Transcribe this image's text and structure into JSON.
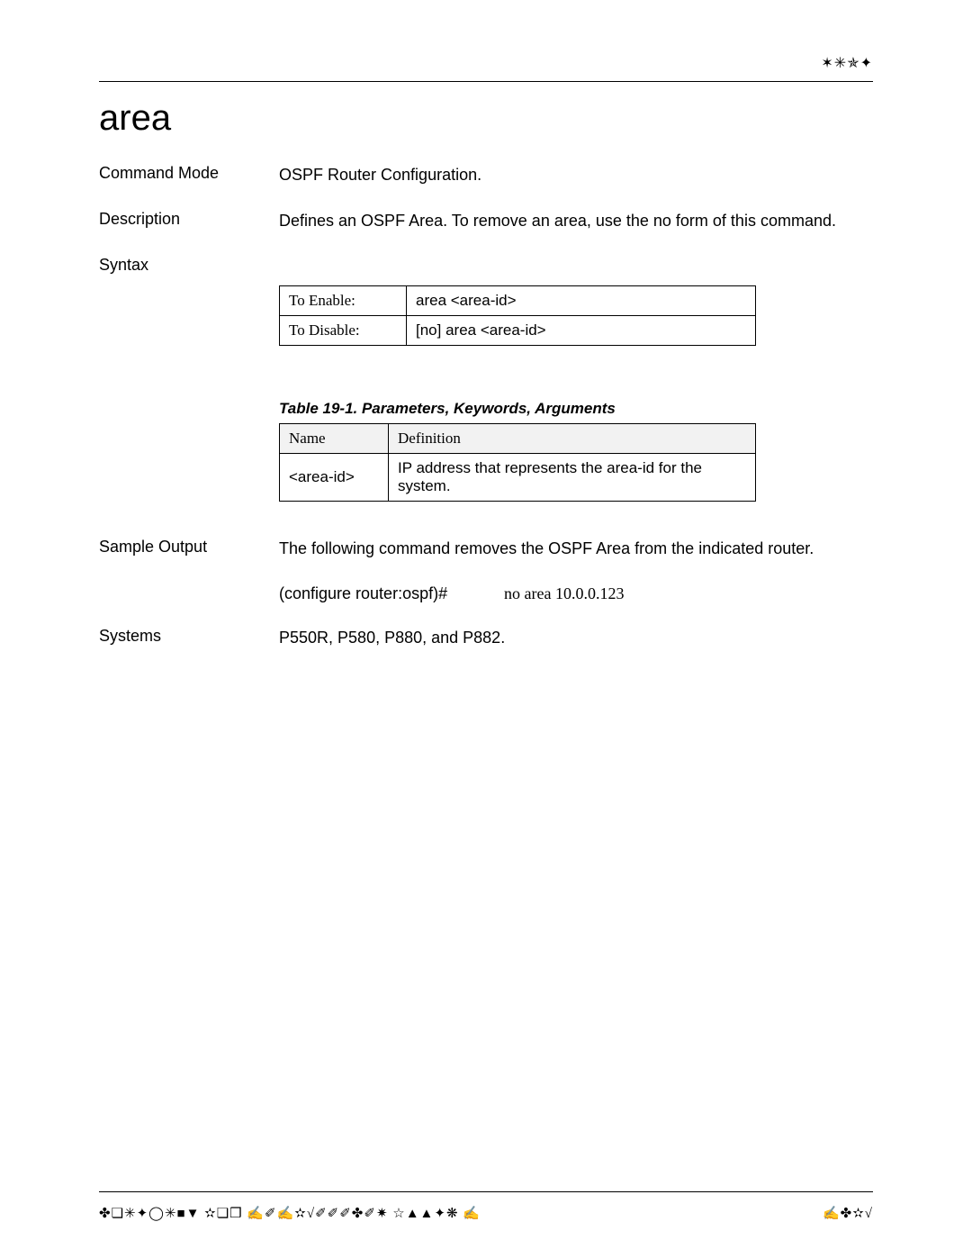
{
  "header": {
    "right_symbols": "✶✳✯✦"
  },
  "title": "area",
  "sections": {
    "command_mode": {
      "label": "Command Mode",
      "value": "OSPF Router Configuration."
    },
    "description": {
      "label": "Description",
      "value": "Defines an OSPF Area. To remove an area, use the no form of this command."
    },
    "syntax": {
      "label": "Syntax",
      "rows": [
        {
          "action": "To Enable:",
          "command": "area <area-id>"
        },
        {
          "action": "To Disable:",
          "command": "[no] area <area-id>"
        }
      ]
    },
    "params": {
      "caption": "Table 19-1.  Parameters, Keywords, Arguments",
      "headers": {
        "name": "Name",
        "definition": "Definition"
      },
      "rows": [
        {
          "name": "<area-id>",
          "definition": "IP address that represents the area-id for the system."
        }
      ]
    },
    "sample_output": {
      "label": "Sample Output",
      "intro": "The following command removes the OSPF Area from the indicated router.",
      "prompt": "(configure router:ospf)#",
      "command": "no area 10.0.0.123"
    },
    "systems": {
      "label": "Systems",
      "value": "P550R, P580, P880, and P882."
    }
  },
  "footer": {
    "left": "✤❏✳✦◯✳■▼ ✫❏❒ ✍✐✍✫√✐✐✐✤✐✷ ☆▲▲✦❋ ✍",
    "right": "✍✤✫√"
  }
}
